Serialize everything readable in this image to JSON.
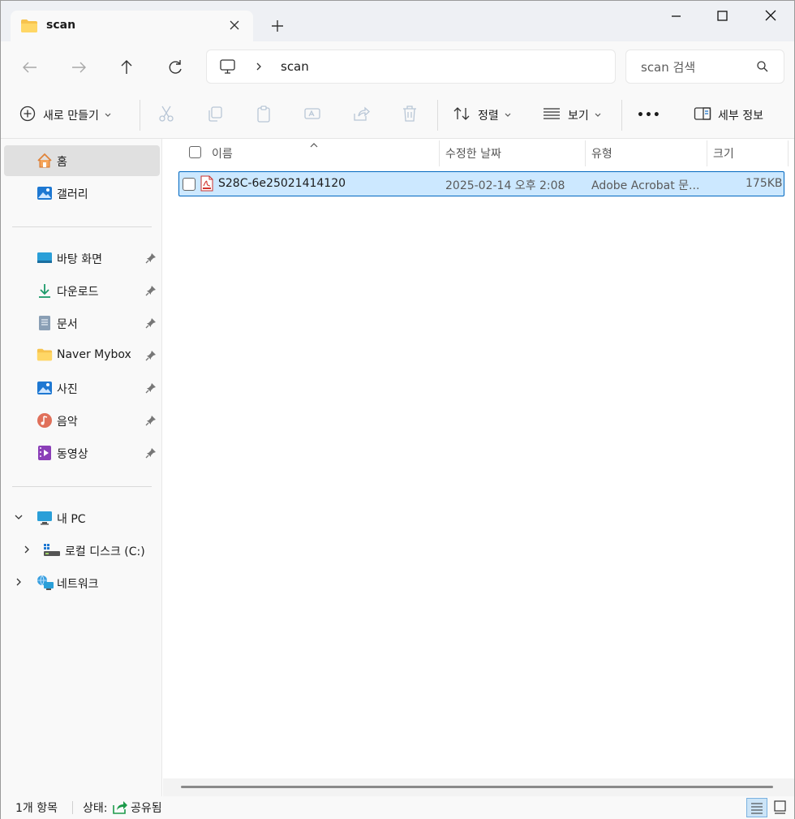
{
  "tab": {
    "title": "scan"
  },
  "address": {
    "crumb": "scan"
  },
  "search": {
    "placeholder": "scan 검색"
  },
  "commands": {
    "new_label": "새로 만들기",
    "sort_label": "정렬",
    "view_label": "보기",
    "more_label": "•••",
    "details_label": "세부 정보"
  },
  "sidebar": {
    "items": [
      {
        "label": "홈"
      },
      {
        "label": "갤러리"
      },
      {
        "label": "바탕 화면"
      },
      {
        "label": "다운로드"
      },
      {
        "label": "문서"
      },
      {
        "label": "Naver Mybox"
      },
      {
        "label": "사진"
      },
      {
        "label": "음악"
      },
      {
        "label": "동영상"
      },
      {
        "label": "내 PC"
      },
      {
        "label": "로컬 디스크 (C:)"
      },
      {
        "label": "네트워크"
      }
    ]
  },
  "columns": {
    "name": "이름",
    "modified": "수정한 날짜",
    "type": "유형",
    "size": "크기"
  },
  "files": [
    {
      "name": "S28C-6e25021414120",
      "modified": "2025-02-14 오후 2:08",
      "type": "Adobe Acrobat 문...",
      "size": "175KB"
    }
  ],
  "status": {
    "count": "1개 항목",
    "state_label": "상태:",
    "state_value": "공유됨"
  },
  "colors": {
    "selection_bg": "#cce8ff",
    "selection_border": "#0067c0",
    "chrome_bg": "#eef0f4",
    "pane_bg": "#f9f9f9"
  }
}
